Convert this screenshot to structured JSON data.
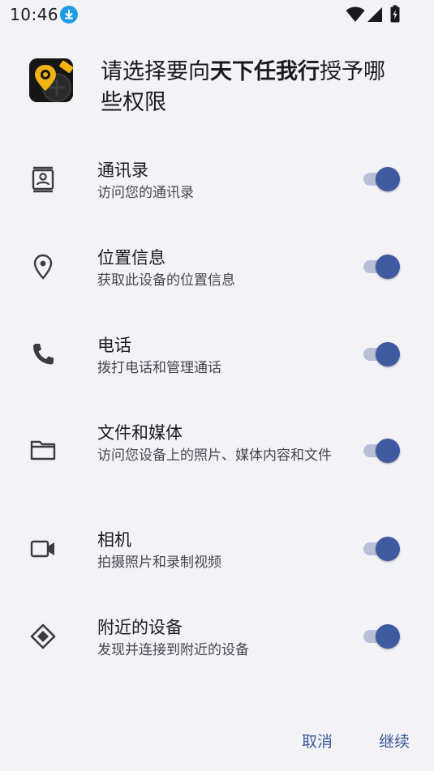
{
  "status": {
    "time": "10:46",
    "download_icon": "download-icon",
    "wifi_icon": "wifi-icon",
    "signal_icon": "signal-icon",
    "battery_icon": "battery-charging-icon"
  },
  "header": {
    "title_prefix": "请选择要向",
    "app_name": "天下任我行",
    "title_suffix": "授予哪些权限",
    "app_icon": "app-logo-pro"
  },
  "permissions": [
    {
      "title": "通讯录",
      "desc": "访问您的通讯录",
      "icon": "contacts-icon",
      "enabled": true
    },
    {
      "title": "位置信息",
      "desc": "获取此设备的位置信息",
      "icon": "location-icon",
      "enabled": true
    },
    {
      "title": "电话",
      "desc": "拨打电话和管理通话",
      "icon": "phone-icon",
      "enabled": true
    },
    {
      "title": "文件和媒体",
      "desc": "访问您设备上的照片、媒体内容和文件",
      "icon": "folder-icon",
      "enabled": true
    },
    {
      "title": "相机",
      "desc": "拍摄照片和录制视频",
      "icon": "camera-icon",
      "enabled": true
    },
    {
      "title": "附近的设备",
      "desc": "发现并连接到附近的设备",
      "icon": "nearby-devices-icon",
      "enabled": true
    }
  ],
  "actions": {
    "cancel": "取消",
    "continue": "继续"
  },
  "colors": {
    "accent": "#3f5aa0",
    "track": "#b8c0d8",
    "background": "#f3f2f7",
    "button_text": "#3c5a9c"
  }
}
